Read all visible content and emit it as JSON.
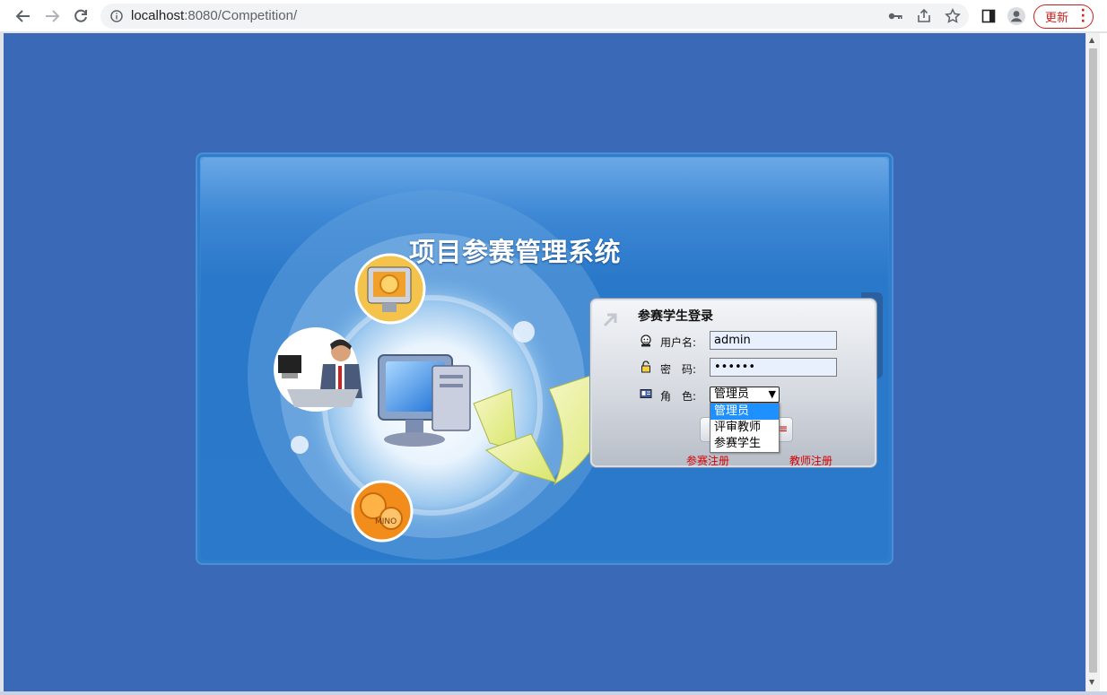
{
  "browser": {
    "url_host": "localhost",
    "url_path": ":8080/Competition/",
    "update_label": "更新"
  },
  "page": {
    "system_title": "项目参赛管理系统"
  },
  "login": {
    "title": "参赛学生登录",
    "username_label": "用户名:",
    "username_value": "admin",
    "password_label": "密　码:",
    "password_value": "••••••",
    "role_label": "角　色:",
    "role_selected": "管理员",
    "role_options": [
      "管理员",
      "评审教师",
      "参赛学生"
    ],
    "student_register": "参赛注册",
    "teacher_register": "教师注册"
  },
  "colors": {
    "page_bg": "#3a6ab7",
    "panel_blue": "#2b79ca",
    "link_red": "#d40000",
    "option_highlight": "#1e90ff"
  }
}
